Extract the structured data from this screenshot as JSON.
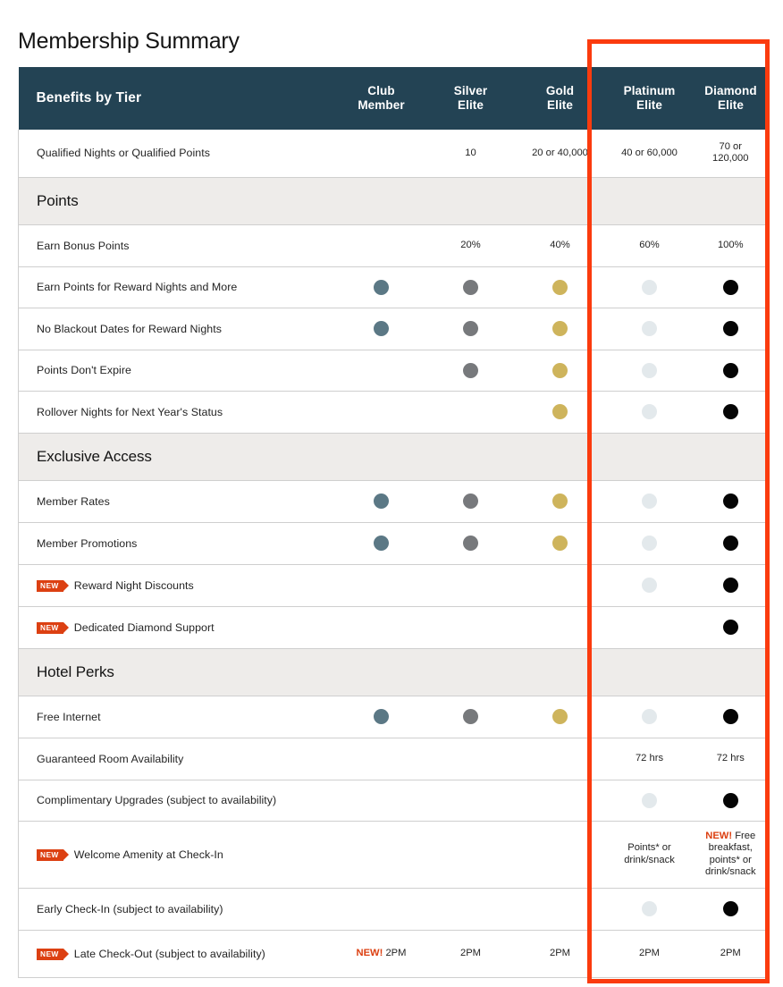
{
  "page": {
    "title": "Membership Summary"
  },
  "highlight": {
    "color": "#fb3b0e",
    "covers": [
      "Platinum Elite",
      "Diamond Elite"
    ]
  },
  "theme": {
    "header_bg": "#234354",
    "section_bg": "#eeecea",
    "border": "#cfcfcf",
    "new_badge": "#dc4012",
    "dot_club": "#5b7885",
    "dot_silver": "#77797c",
    "dot_gold": "#ceb45c",
    "dot_platinum": "#e3e9ec",
    "dot_diamond": "#050505"
  },
  "table": {
    "header": {
      "label": "Benefits by Tier",
      "tiers": [
        {
          "line1": "Club",
          "line2": "Member"
        },
        {
          "line1": "Silver",
          "line2": "Elite"
        },
        {
          "line1": "Gold",
          "line2": "Elite"
        },
        {
          "line1": "Platinum",
          "line2": "Elite"
        },
        {
          "line1": "Diamond",
          "line2": "Elite"
        }
      ]
    },
    "rows": [
      {
        "type": "data",
        "height": "h53",
        "new": false,
        "label": "Qualified Nights or Qualified Points",
        "cells": [
          {
            "kind": "empty",
            "text": ""
          },
          {
            "kind": "text",
            "text": "10"
          },
          {
            "kind": "text",
            "text": "20 or 40,000"
          },
          {
            "kind": "text",
            "text": "40 or 60,000"
          },
          {
            "kind": "text",
            "text": "70 or\n120,000"
          }
        ]
      },
      {
        "type": "section",
        "label": "Points"
      },
      {
        "type": "data",
        "height": "h47",
        "new": false,
        "label": "Earn Bonus Points",
        "cells": [
          {
            "kind": "empty",
            "text": ""
          },
          {
            "kind": "text",
            "text": "20%"
          },
          {
            "kind": "text",
            "text": "40%"
          },
          {
            "kind": "text",
            "text": "60%"
          },
          {
            "kind": "text",
            "text": "100%"
          }
        ]
      },
      {
        "type": "data",
        "height": "h46",
        "new": false,
        "label": "Earn Points for Reward Nights and More",
        "cells": [
          {
            "kind": "dot",
            "dot": "club"
          },
          {
            "kind": "dot",
            "dot": "silver"
          },
          {
            "kind": "dot",
            "dot": "gold"
          },
          {
            "kind": "dot",
            "dot": "platinum"
          },
          {
            "kind": "dot",
            "dot": "diamond"
          }
        ]
      },
      {
        "type": "data",
        "height": "h47",
        "new": false,
        "label": "No Blackout Dates for Reward Nights",
        "cells": [
          {
            "kind": "dot",
            "dot": "club"
          },
          {
            "kind": "dot",
            "dot": "silver"
          },
          {
            "kind": "dot",
            "dot": "gold"
          },
          {
            "kind": "dot",
            "dot": "platinum"
          },
          {
            "kind": "dot",
            "dot": "diamond"
          }
        ]
      },
      {
        "type": "data",
        "height": "h46",
        "new": false,
        "label": "Points Don't Expire",
        "cells": [
          {
            "kind": "empty",
            "text": ""
          },
          {
            "kind": "dot",
            "dot": "silver"
          },
          {
            "kind": "dot",
            "dot": "gold"
          },
          {
            "kind": "dot",
            "dot": "platinum"
          },
          {
            "kind": "dot",
            "dot": "diamond"
          }
        ]
      },
      {
        "type": "data",
        "height": "h47",
        "new": false,
        "label": "Rollover Nights for Next Year's Status",
        "cells": [
          {
            "kind": "empty",
            "text": ""
          },
          {
            "kind": "empty",
            "text": ""
          },
          {
            "kind": "dot",
            "dot": "gold"
          },
          {
            "kind": "dot",
            "dot": "platinum"
          },
          {
            "kind": "dot",
            "dot": "diamond"
          }
        ]
      },
      {
        "type": "section",
        "label": "Exclusive Access"
      },
      {
        "type": "data",
        "height": "h47",
        "new": false,
        "label": "Member Rates",
        "cells": [
          {
            "kind": "dot",
            "dot": "club"
          },
          {
            "kind": "dot",
            "dot": "silver"
          },
          {
            "kind": "dot",
            "dot": "gold"
          },
          {
            "kind": "dot",
            "dot": "platinum"
          },
          {
            "kind": "dot",
            "dot": "diamond"
          }
        ]
      },
      {
        "type": "data",
        "height": "h47",
        "new": false,
        "label": "Member Promotions",
        "cells": [
          {
            "kind": "dot",
            "dot": "club"
          },
          {
            "kind": "dot",
            "dot": "silver"
          },
          {
            "kind": "dot",
            "dot": "gold"
          },
          {
            "kind": "dot",
            "dot": "platinum"
          },
          {
            "kind": "dot",
            "dot": "diamond"
          }
        ]
      },
      {
        "type": "data",
        "height": "h47",
        "new": true,
        "new_label": "NEW",
        "label": "Reward Night Discounts",
        "cells": [
          {
            "kind": "empty",
            "text": ""
          },
          {
            "kind": "empty",
            "text": ""
          },
          {
            "kind": "empty",
            "text": ""
          },
          {
            "kind": "dot",
            "dot": "platinum"
          },
          {
            "kind": "dot",
            "dot": "diamond"
          }
        ]
      },
      {
        "type": "data",
        "height": "h47",
        "new": true,
        "new_label": "NEW",
        "label": "Dedicated Diamond Support",
        "cells": [
          {
            "kind": "empty",
            "text": ""
          },
          {
            "kind": "empty",
            "text": ""
          },
          {
            "kind": "empty",
            "text": ""
          },
          {
            "kind": "empty",
            "text": ""
          },
          {
            "kind": "dot",
            "dot": "diamond"
          }
        ]
      },
      {
        "type": "section",
        "label": "Hotel Perks"
      },
      {
        "type": "data",
        "height": "h47",
        "new": false,
        "label": "Free Internet",
        "cells": [
          {
            "kind": "dot",
            "dot": "club"
          },
          {
            "kind": "dot",
            "dot": "silver"
          },
          {
            "kind": "dot",
            "dot": "gold"
          },
          {
            "kind": "dot",
            "dot": "platinum"
          },
          {
            "kind": "dot",
            "dot": "diamond"
          }
        ]
      },
      {
        "type": "data",
        "height": "h47",
        "new": false,
        "label": "Guaranteed Room Availability",
        "cells": [
          {
            "kind": "empty",
            "text": ""
          },
          {
            "kind": "empty",
            "text": ""
          },
          {
            "kind": "empty",
            "text": ""
          },
          {
            "kind": "text",
            "text": "72 hrs"
          },
          {
            "kind": "text",
            "text": "72 hrs"
          }
        ]
      },
      {
        "type": "data",
        "height": "h46",
        "new": false,
        "label": "Complimentary Upgrades (subject to availability)",
        "cells": [
          {
            "kind": "empty",
            "text": ""
          },
          {
            "kind": "empty",
            "text": ""
          },
          {
            "kind": "empty",
            "text": ""
          },
          {
            "kind": "dot",
            "dot": "platinum"
          },
          {
            "kind": "dot",
            "dot": "diamond"
          }
        ]
      },
      {
        "type": "data",
        "height": "h75",
        "new": true,
        "new_label": "NEW",
        "label": "Welcome Amenity at Check-In",
        "cells": [
          {
            "kind": "empty",
            "text": ""
          },
          {
            "kind": "empty",
            "text": ""
          },
          {
            "kind": "empty",
            "text": ""
          },
          {
            "kind": "text",
            "text": "Points* or\ndrink/snack"
          },
          {
            "kind": "text",
            "prefix_new": "NEW!",
            "text": " Free\nbreakfast,\npoints* or\ndrink/snack"
          }
        ]
      },
      {
        "type": "data",
        "height": "h47",
        "new": false,
        "label": "Early Check-In (subject to availability)",
        "cells": [
          {
            "kind": "empty",
            "text": ""
          },
          {
            "kind": "empty",
            "text": ""
          },
          {
            "kind": "empty",
            "text": ""
          },
          {
            "kind": "dot",
            "dot": "platinum"
          },
          {
            "kind": "dot",
            "dot": "diamond"
          }
        ]
      },
      {
        "type": "data",
        "height": "h53",
        "new": true,
        "new_label": "NEW",
        "label": "Late Check-Out (subject to availability)",
        "cells": [
          {
            "kind": "text",
            "prefix_new": "NEW!",
            "text": " 2PM"
          },
          {
            "kind": "text",
            "text": "2PM"
          },
          {
            "kind": "text",
            "text": "2PM"
          },
          {
            "kind": "text",
            "text": "2PM"
          },
          {
            "kind": "text",
            "text": "2PM"
          }
        ]
      }
    ]
  }
}
